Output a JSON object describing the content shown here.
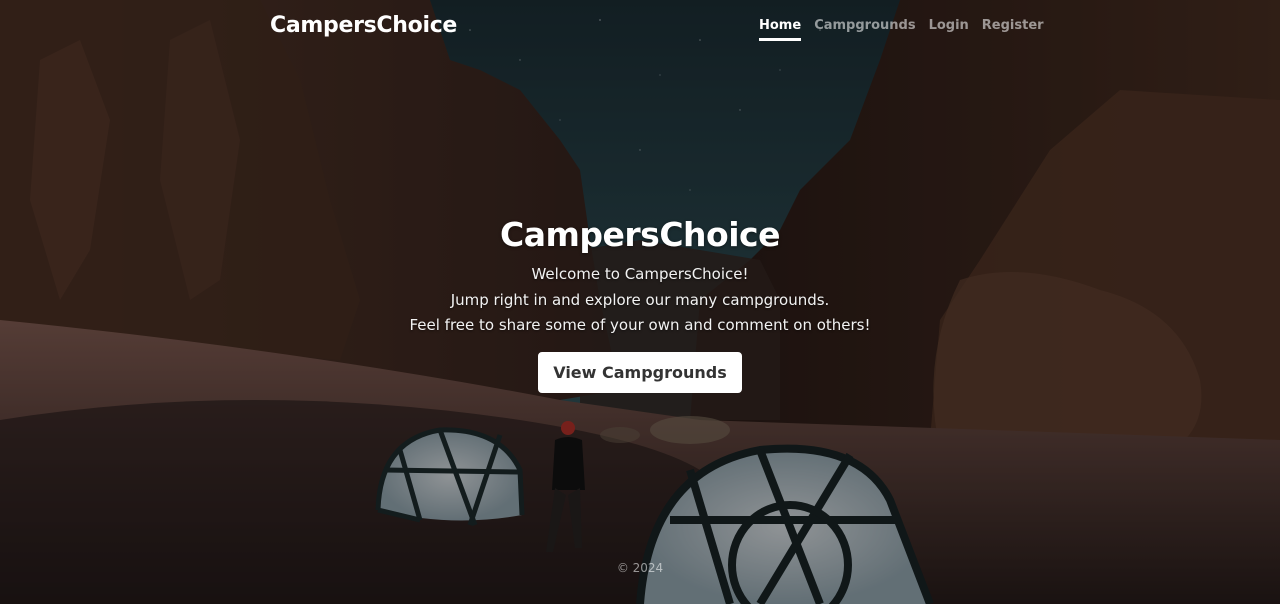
{
  "header": {
    "brand": "CampersChoice",
    "nav": [
      {
        "label": "Home",
        "active": true
      },
      {
        "label": "Campgrounds",
        "active": false
      },
      {
        "label": "Login",
        "active": false
      },
      {
        "label": "Register",
        "active": false
      }
    ]
  },
  "hero": {
    "title": "CampersChoice",
    "lines": [
      "Welcome to CampersChoice!",
      "Jump right in and explore our many campgrounds.",
      "Feel free to share some of your own and comment on others!"
    ],
    "button_label": "View Campgrounds"
  },
  "footer": {
    "text": "© 2024"
  },
  "colors": {
    "sky": "#2e4a52",
    "rock": "#4a2e24",
    "sand": "#3a2a26",
    "button_bg": "#ffffff",
    "button_text": "#333333"
  }
}
